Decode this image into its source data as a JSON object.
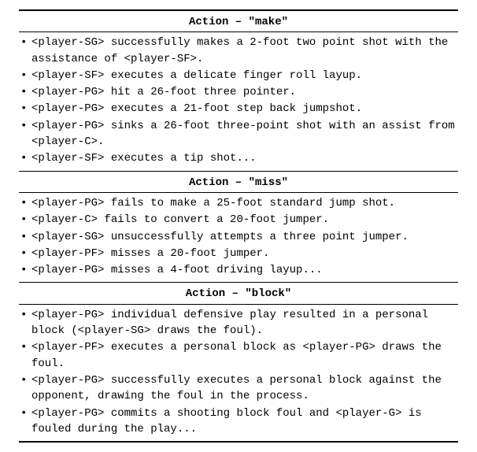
{
  "sections": [
    {
      "title": "Action – \"make\"",
      "items": [
        "<player-SG> successfully makes a 2-foot two point shot with the assistance of <player-SF>.",
        "<player-SF> executes a delicate finger roll layup.",
        "<player-PG> hit a 26-foot three pointer.",
        "<player-PG> executes a 21-foot step back jumpshot.",
        "<player-PG> sinks a 26-foot three-point shot with an assist from <player-C>.",
        "<player-SF> executes a tip shot..."
      ]
    },
    {
      "title": "Action – \"miss\"",
      "items": [
        "<player-PG> fails to make a 25-foot standard jump shot.",
        "<player-C> fails to convert a 20-foot jumper.",
        "<player-SG> unsuccessfully attempts a three point jumper.",
        "<player-PF> misses a 20-foot jumper.",
        "<player-PG> misses a 4-foot driving layup..."
      ]
    },
    {
      "title": "Action – \"block\"",
      "items": [
        "<player-PG> individual defensive play resulted in a personal block (<player-SG> draws the foul).",
        "<player-PF> executes a personal block as <player-PG> draws the foul.",
        "<player-PG> successfully executes a personal block against the opponent, drawing the foul in the process.",
        "<player-PG> commits a shooting block foul and <player-G> is fouled during the play..."
      ]
    }
  ]
}
